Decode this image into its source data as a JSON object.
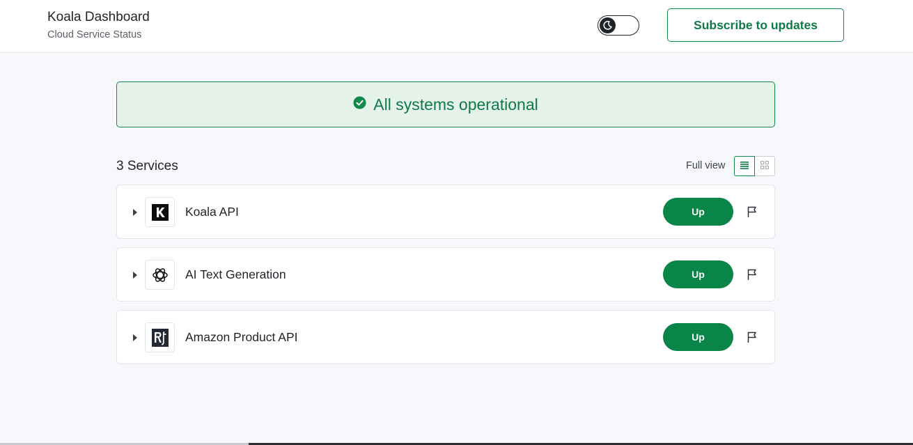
{
  "header": {
    "title": "Koala Dashboard",
    "subtitle": "Cloud Service Status",
    "theme_toggle_icon": "moon-icon",
    "subscribe_label": "Subscribe to updates"
  },
  "status": {
    "icon": "check-circle-icon",
    "text": "All systems operational",
    "color": "#0f7a45"
  },
  "services_section": {
    "count_label": "3 Services",
    "view_label": "Full view",
    "view_modes": [
      "list",
      "grid"
    ],
    "selected_view": "list"
  },
  "services": [
    {
      "name": "Koala API",
      "logo": "koala-k-logo",
      "status": "Up"
    },
    {
      "name": "AI Text Generation",
      "logo": "openai-logo",
      "status": "Up"
    },
    {
      "name": "Amazon Product API",
      "logo": "rainforest-rj-logo",
      "status": "Up"
    }
  ],
  "colors": {
    "accent": "#0a8548",
    "banner_bg": "#e5f3ea",
    "page_bg": "#f7f8fb"
  }
}
